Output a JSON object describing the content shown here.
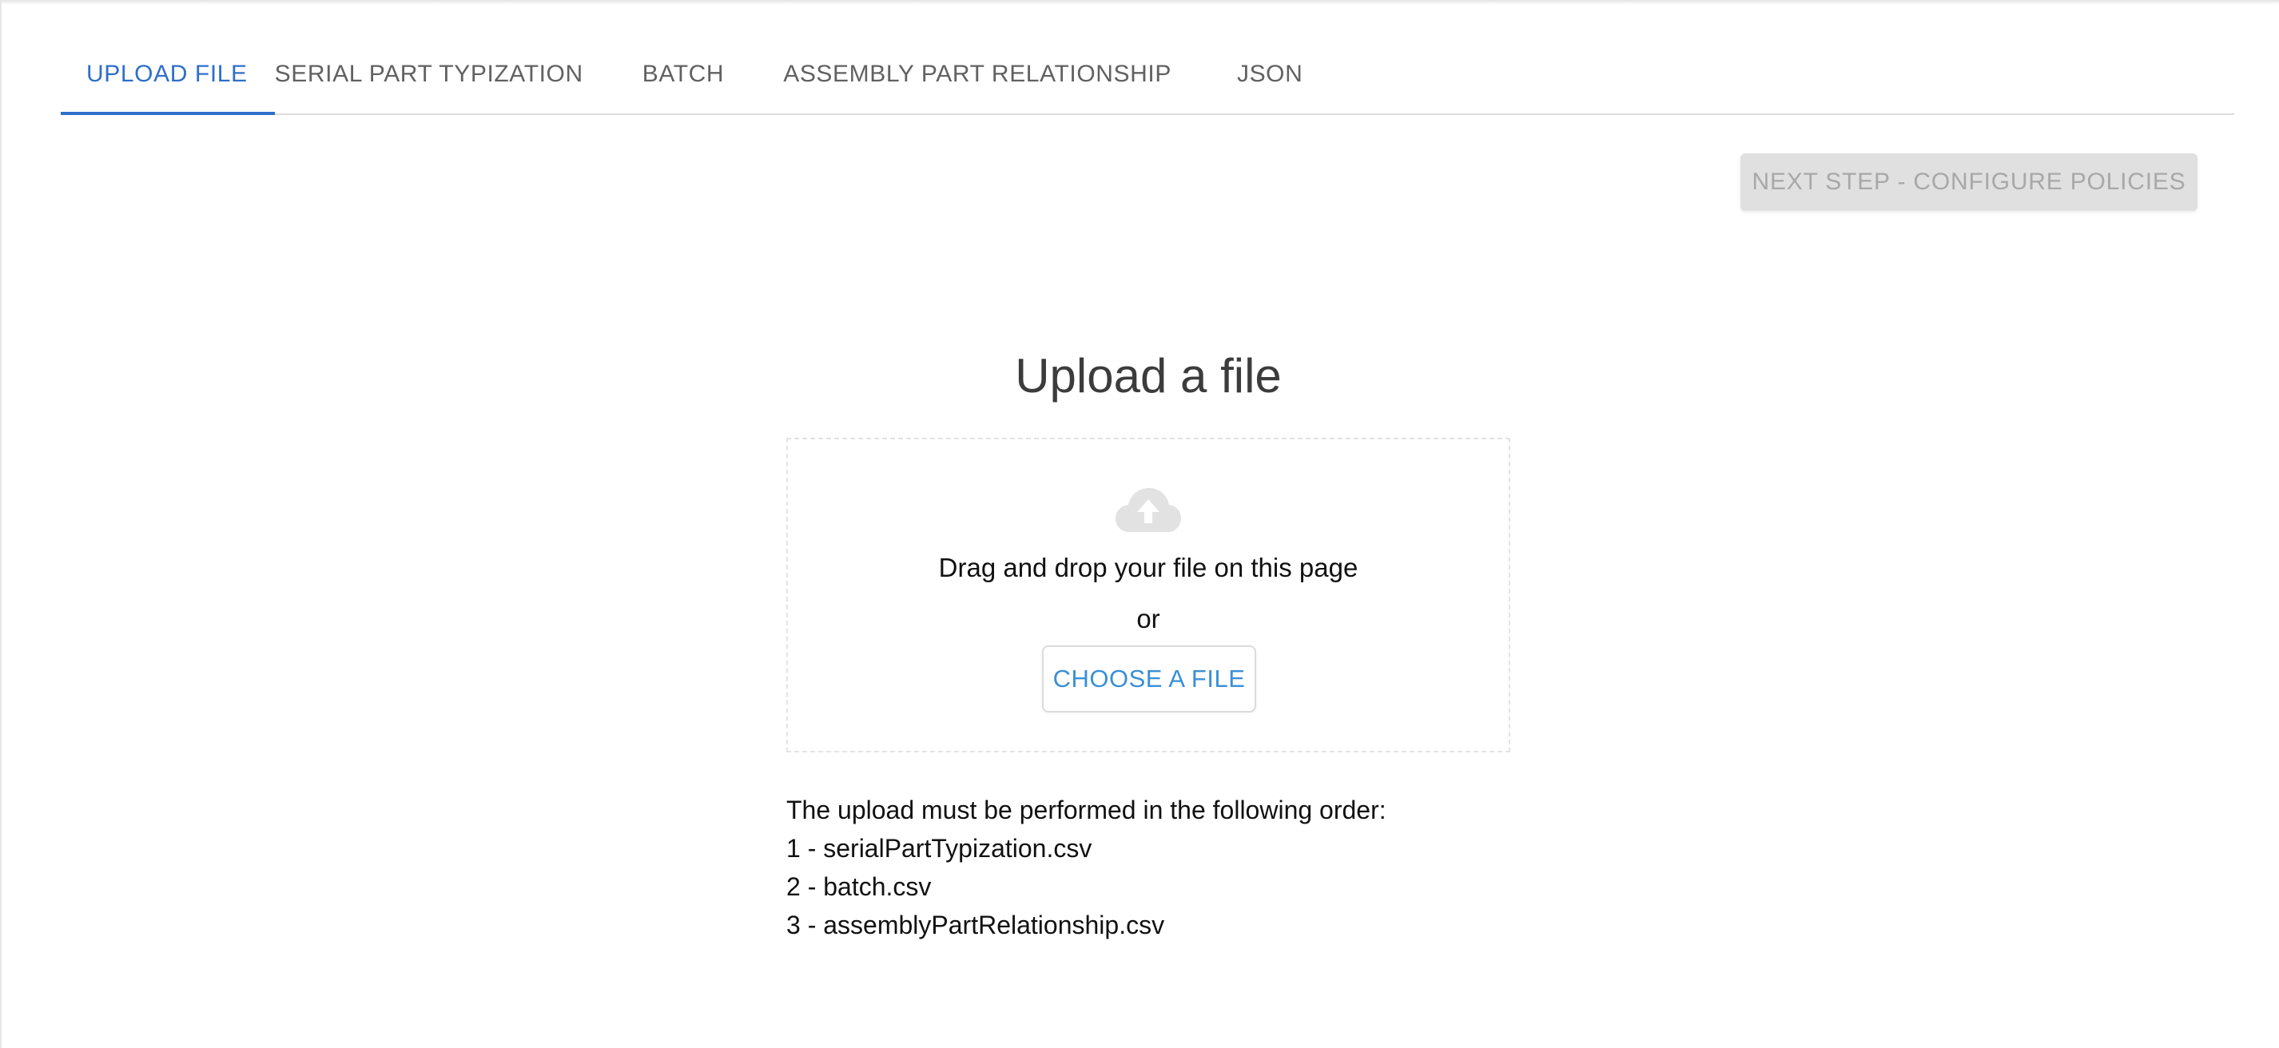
{
  "tabs": [
    {
      "label": "UPLOAD FILE",
      "active": true
    },
    {
      "label": "SERIAL PART TYPIZATION",
      "active": false
    },
    {
      "label": "BATCH",
      "active": false
    },
    {
      "label": "ASSEMBLY PART RELATIONSHIP",
      "active": false
    },
    {
      "label": "JSON",
      "active": false
    }
  ],
  "toolbar": {
    "next_step_label": "NEXT STEP - CONFIGURE POLICIES",
    "next_step_disabled": true
  },
  "upload": {
    "title": "Upload a file",
    "icon": "cloud-upload-icon",
    "drag_text": "Drag and drop your file on this page",
    "or_text": "or",
    "choose_label": "CHOOSE A FILE"
  },
  "instructions": {
    "intro": "The upload must be performed in the following order:",
    "steps": [
      "1 - serialPartTypization.csv",
      "2 - batch.csv",
      "3 - assemblyPartRelationship.csv"
    ]
  },
  "colors": {
    "accent": "#2f6fc9",
    "link": "#3a8fd6",
    "disabled_bg": "#e0e0e0",
    "disabled_text": "#a8a8a8",
    "icon": "#e2e2e2"
  }
}
